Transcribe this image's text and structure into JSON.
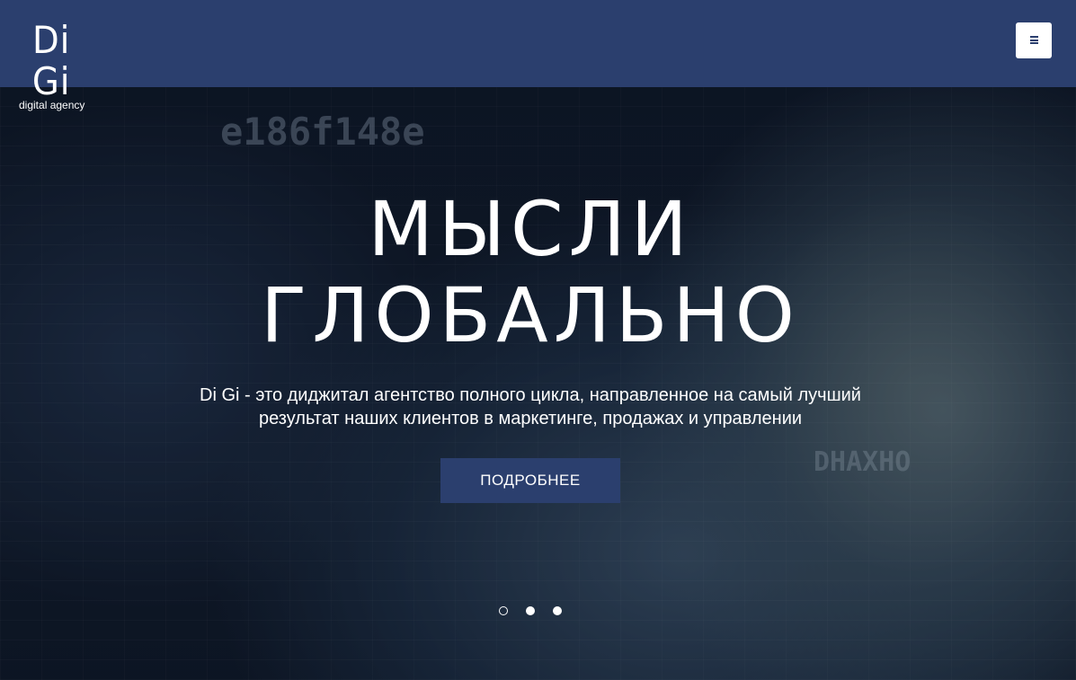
{
  "header": {
    "logo_main": "Di Gi",
    "logo_sub": "digital agency",
    "menu_icon": "hamburger-menu-icon"
  },
  "hero": {
    "title_line1": "МЫСЛИ",
    "title_line2": "ГЛОБАЛЬНО",
    "subtitle_line1": "Di Gi - это диджитал агентство полного цикла, направленное на самый лучший",
    "subtitle_line2": "результат наших клиентов в маркетинге, продажах и управлении",
    "cta_label": "ПОДРОБНЕЕ",
    "background_big_code": "e186f148e",
    "background_right_code": "DHAXHO"
  },
  "slider": {
    "slide_count": 3,
    "active_index": 0
  },
  "colors": {
    "brand": "#2b3f6e",
    "text": "#ffffff"
  }
}
